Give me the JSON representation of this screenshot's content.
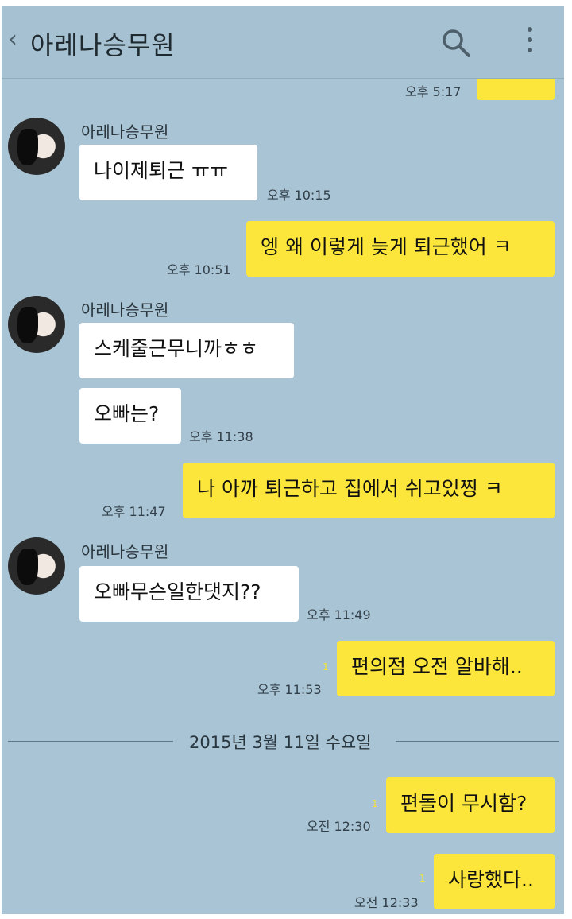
{
  "header": {
    "title": "아레나승무원"
  },
  "messages": {
    "m0": {
      "time": "오후 5:17"
    },
    "m1": {
      "sender": "아레나승무원",
      "text": "나이제퇴근 ㅠㅠ",
      "time": "오후 10:15"
    },
    "m2": {
      "text": "엥 왜 이렇게 늦게 퇴근했어 ㅋ",
      "time": "오후 10:51"
    },
    "m3": {
      "sender": "아레나승무원",
      "text": "스케줄근무니까ㅎㅎ"
    },
    "m4": {
      "text": "오빠는?",
      "time": "오후 11:38"
    },
    "m5": {
      "text": "나 아까 퇴근하고 집에서 쉬고있찡 ㅋ",
      "time": "오후 11:47"
    },
    "m6": {
      "sender": "아레나승무원",
      "text": "오빠무슨일한댓지??",
      "time": "오후 11:49"
    },
    "m7": {
      "text": "편의점 오전 알바해..",
      "time": "오후 11:53",
      "unread": "1"
    },
    "m8": {
      "text": "편돌이 무시함?",
      "time": "오전 12:30",
      "unread": "1"
    },
    "m9": {
      "text": "사랑했다..",
      "time": "오전 12:33",
      "unread": "1"
    }
  },
  "date_separator": "2015년 3월 11일 수요일",
  "colors": {
    "background": "#a9c4d4",
    "outgoing_bubble": "#fde63b",
    "incoming_bubble": "#ffffff"
  },
  "icons": [
    "back-icon",
    "search-icon",
    "more-icon"
  ]
}
